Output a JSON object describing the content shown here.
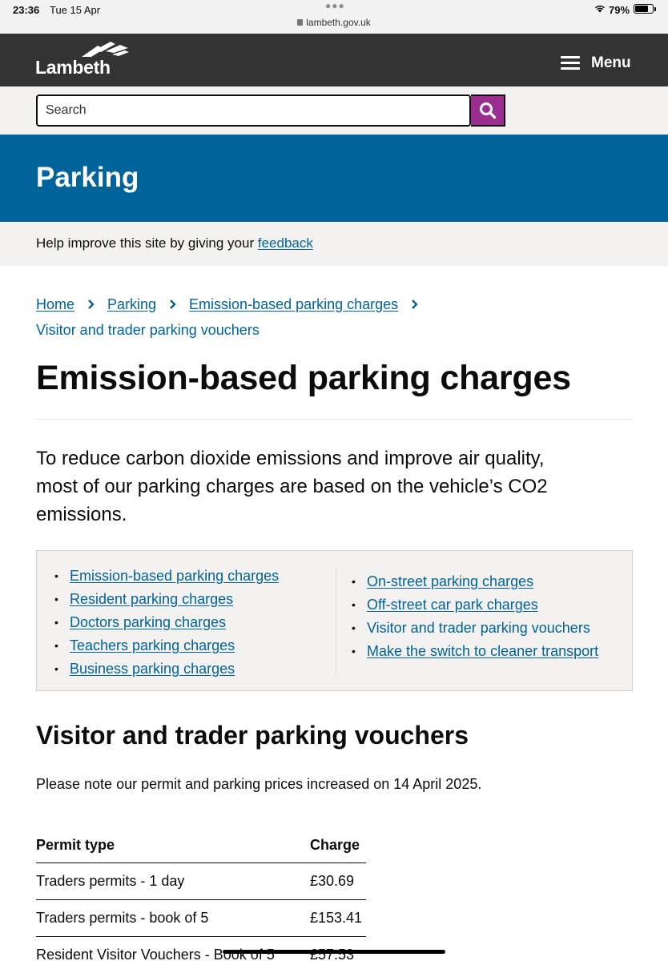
{
  "status_bar": {
    "time": "23:36",
    "date": "Tue 15 Apr",
    "url": "lambeth.gov.uk",
    "battery_text": "79%",
    "battery_level": 0.79
  },
  "header": {
    "logo_text": "Lambeth",
    "menu_label": "Menu",
    "colors": {
      "background": "#333333",
      "text": "#ffffff"
    }
  },
  "search": {
    "placeholder": "Search",
    "button_color": "#9a2d8f",
    "icon": "search-icon"
  },
  "banner": {
    "title": "Parking",
    "color": "#00639a"
  },
  "feedback": {
    "text": "Help improve this site by giving your",
    "link": "feedback"
  },
  "breadcrumb": [
    {
      "label": "Home"
    },
    {
      "label": "Parking"
    },
    {
      "label": "Emission-based parking charges"
    },
    {
      "label": "Visitor and trader parking vouchers"
    }
  ],
  "page": {
    "title": "Emission-based parking charges",
    "lead": "To reduce carbon dioxide emissions and improve air quality, most of our parking charges are based on the vehicle’s CO2 emissions."
  },
  "related_links": {
    "column1": [
      {
        "label": "Emission-based parking charges",
        "current": false
      },
      {
        "label": "Resident parking charges",
        "current": false
      },
      {
        "label": "Doctors parking charges",
        "current": false
      },
      {
        "label": "Teachers parking charges",
        "current": false
      },
      {
        "label": "Business parking charges",
        "current": false
      }
    ],
    "column2": [
      {
        "label": "On-street parking charges",
        "current": false
      },
      {
        "label": "Off-street car park charges",
        "current": false
      },
      {
        "label": "Visitor and trader parking vouchers",
        "current": true
      },
      {
        "label": "Make the switch to cleaner transport",
        "current": false
      }
    ]
  },
  "section": {
    "heading": "Visitor and trader parking vouchers",
    "notice": "Please note our permit and parking prices increased on 14 April 2025."
  },
  "table": {
    "headers": [
      "Permit type",
      "Charge"
    ],
    "rows": [
      [
        "Traders permits - 1 day",
        "£30.69"
      ],
      [
        "Traders permits - book of 5",
        "£153.41"
      ],
      [
        "Resident Visitor Vouchers - Book of 5",
        "£57.53"
      ]
    ]
  },
  "link_color": "#00639a"
}
